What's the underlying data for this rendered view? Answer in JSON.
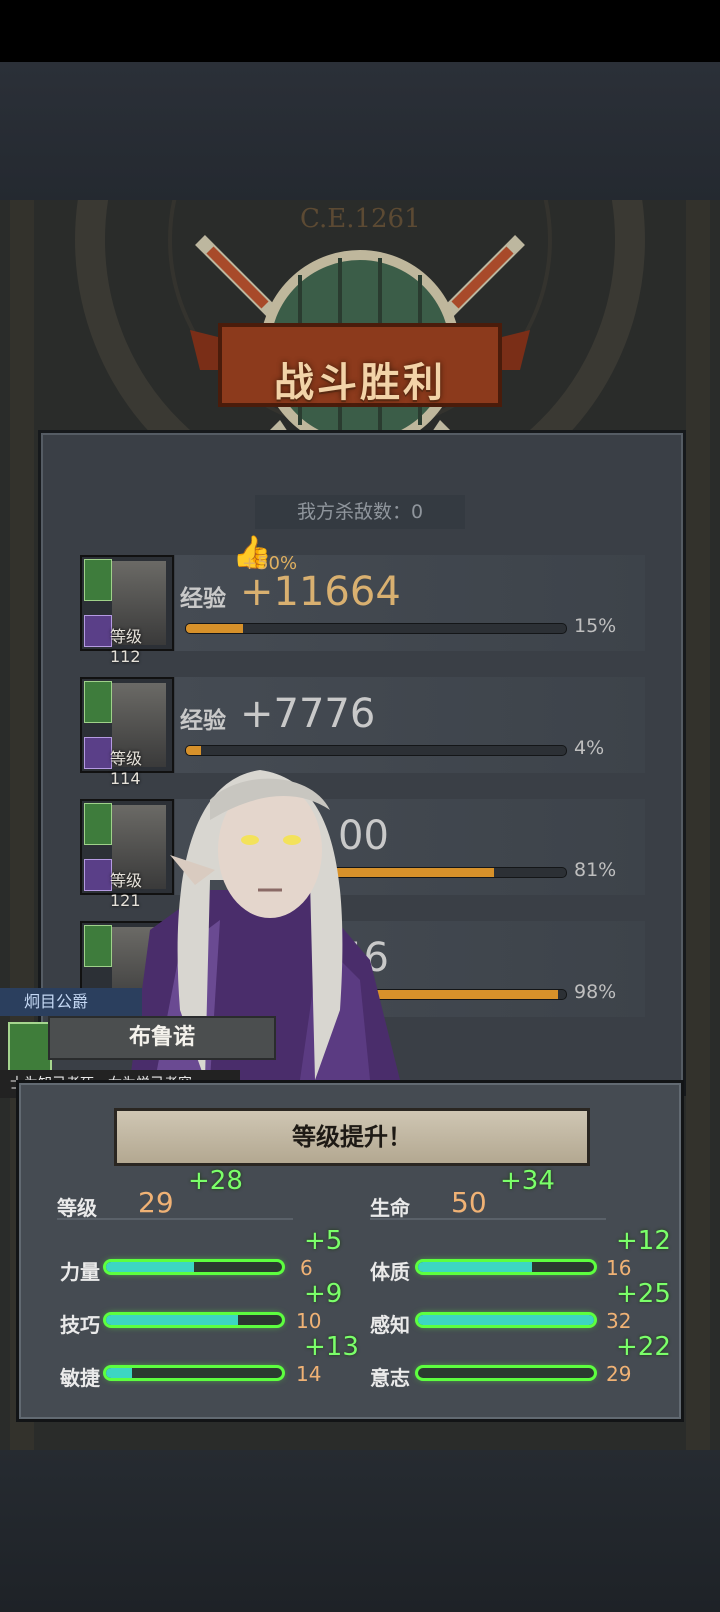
{
  "header": {
    "era_label": "C.E.1261",
    "result_title": "战斗胜利",
    "kills_text": "我方杀敌数：0"
  },
  "heroes": [
    {
      "level_label": "等级112",
      "exp_label": "经验",
      "exp_value": "+11664",
      "bonus": "+50%",
      "progress_pct": 15,
      "pct_text": "15%",
      "thumbs": true
    },
    {
      "level_label": "等级114",
      "exp_label": "经验",
      "exp_value": "+7776",
      "bonus": "",
      "progress_pct": 4,
      "pct_text": "4%",
      "thumbs": false
    },
    {
      "level_label": "等级121",
      "exp_label": "",
      "exp_value": "00",
      "bonus": "",
      "progress_pct": 81,
      "pct_text": "81%",
      "thumbs": false
    },
    {
      "level_label": "",
      "exp_label": "",
      "exp_value": "46",
      "bonus": "",
      "progress_pct": 98,
      "pct_text": "98%",
      "thumbs": false
    }
  ],
  "character": {
    "title": "炯目公爵",
    "name": "布鲁诺",
    "quote": "士为知己者死，女为悦己者容"
  },
  "level_up": {
    "banner": "等级提升！",
    "level": {
      "label": "等级",
      "value": "29",
      "inc": "+28"
    },
    "hp": {
      "label": "生命",
      "value": "50",
      "inc": "+34"
    },
    "stats_left": [
      {
        "label": "力量",
        "value": "6",
        "inc": "+5",
        "fill": 0.5
      },
      {
        "label": "技巧",
        "value": "10",
        "inc": "+9",
        "fill": 0.75
      },
      {
        "label": "敏捷",
        "value": "14",
        "inc": "+13",
        "fill": 0.15
      }
    ],
    "stats_right": [
      {
        "label": "体质",
        "value": "16",
        "inc": "+12",
        "fill": 0.65
      },
      {
        "label": "感知",
        "value": "32",
        "inc": "+25",
        "fill": 1.0
      },
      {
        "label": "意志",
        "value": "29",
        "inc": "+22",
        "fill": 0.0
      }
    ]
  },
  "colors": {
    "exp_bar": "#d7912a",
    "stat_bar": "#3dd6c2",
    "increase": "#7bff6a",
    "value": "#f0b275"
  }
}
